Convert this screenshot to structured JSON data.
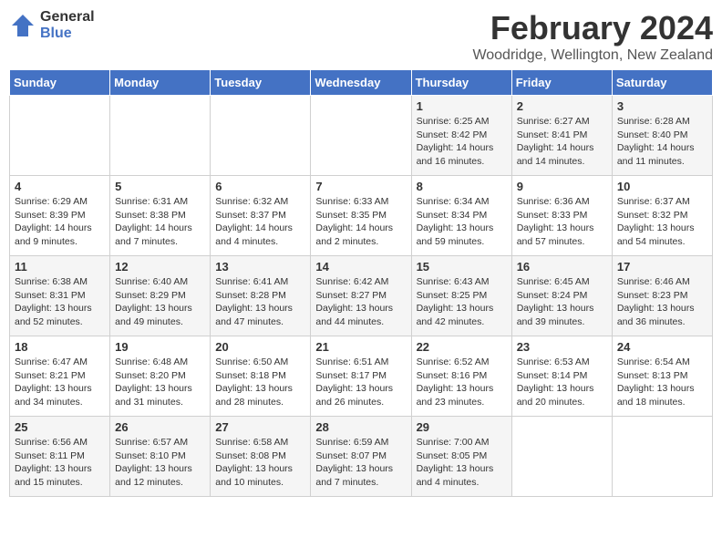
{
  "logo": {
    "general": "General",
    "blue": "Blue"
  },
  "title": "February 2024",
  "subtitle": "Woodridge, Wellington, New Zealand",
  "days_of_week": [
    "Sunday",
    "Monday",
    "Tuesday",
    "Wednesday",
    "Thursday",
    "Friday",
    "Saturday"
  ],
  "weeks": [
    [
      {
        "day": "",
        "info": ""
      },
      {
        "day": "",
        "info": ""
      },
      {
        "day": "",
        "info": ""
      },
      {
        "day": "",
        "info": ""
      },
      {
        "day": "1",
        "info": "Sunrise: 6:25 AM\nSunset: 8:42 PM\nDaylight: 14 hours and 16 minutes."
      },
      {
        "day": "2",
        "info": "Sunrise: 6:27 AM\nSunset: 8:41 PM\nDaylight: 14 hours and 14 minutes."
      },
      {
        "day": "3",
        "info": "Sunrise: 6:28 AM\nSunset: 8:40 PM\nDaylight: 14 hours and 11 minutes."
      }
    ],
    [
      {
        "day": "4",
        "info": "Sunrise: 6:29 AM\nSunset: 8:39 PM\nDaylight: 14 hours and 9 minutes."
      },
      {
        "day": "5",
        "info": "Sunrise: 6:31 AM\nSunset: 8:38 PM\nDaylight: 14 hours and 7 minutes."
      },
      {
        "day": "6",
        "info": "Sunrise: 6:32 AM\nSunset: 8:37 PM\nDaylight: 14 hours and 4 minutes."
      },
      {
        "day": "7",
        "info": "Sunrise: 6:33 AM\nSunset: 8:35 PM\nDaylight: 14 hours and 2 minutes."
      },
      {
        "day": "8",
        "info": "Sunrise: 6:34 AM\nSunset: 8:34 PM\nDaylight: 13 hours and 59 minutes."
      },
      {
        "day": "9",
        "info": "Sunrise: 6:36 AM\nSunset: 8:33 PM\nDaylight: 13 hours and 57 minutes."
      },
      {
        "day": "10",
        "info": "Sunrise: 6:37 AM\nSunset: 8:32 PM\nDaylight: 13 hours and 54 minutes."
      }
    ],
    [
      {
        "day": "11",
        "info": "Sunrise: 6:38 AM\nSunset: 8:31 PM\nDaylight: 13 hours and 52 minutes."
      },
      {
        "day": "12",
        "info": "Sunrise: 6:40 AM\nSunset: 8:29 PM\nDaylight: 13 hours and 49 minutes."
      },
      {
        "day": "13",
        "info": "Sunrise: 6:41 AM\nSunset: 8:28 PM\nDaylight: 13 hours and 47 minutes."
      },
      {
        "day": "14",
        "info": "Sunrise: 6:42 AM\nSunset: 8:27 PM\nDaylight: 13 hours and 44 minutes."
      },
      {
        "day": "15",
        "info": "Sunrise: 6:43 AM\nSunset: 8:25 PM\nDaylight: 13 hours and 42 minutes."
      },
      {
        "day": "16",
        "info": "Sunrise: 6:45 AM\nSunset: 8:24 PM\nDaylight: 13 hours and 39 minutes."
      },
      {
        "day": "17",
        "info": "Sunrise: 6:46 AM\nSunset: 8:23 PM\nDaylight: 13 hours and 36 minutes."
      }
    ],
    [
      {
        "day": "18",
        "info": "Sunrise: 6:47 AM\nSunset: 8:21 PM\nDaylight: 13 hours and 34 minutes."
      },
      {
        "day": "19",
        "info": "Sunrise: 6:48 AM\nSunset: 8:20 PM\nDaylight: 13 hours and 31 minutes."
      },
      {
        "day": "20",
        "info": "Sunrise: 6:50 AM\nSunset: 8:18 PM\nDaylight: 13 hours and 28 minutes."
      },
      {
        "day": "21",
        "info": "Sunrise: 6:51 AM\nSunset: 8:17 PM\nDaylight: 13 hours and 26 minutes."
      },
      {
        "day": "22",
        "info": "Sunrise: 6:52 AM\nSunset: 8:16 PM\nDaylight: 13 hours and 23 minutes."
      },
      {
        "day": "23",
        "info": "Sunrise: 6:53 AM\nSunset: 8:14 PM\nDaylight: 13 hours and 20 minutes."
      },
      {
        "day": "24",
        "info": "Sunrise: 6:54 AM\nSunset: 8:13 PM\nDaylight: 13 hours and 18 minutes."
      }
    ],
    [
      {
        "day": "25",
        "info": "Sunrise: 6:56 AM\nSunset: 8:11 PM\nDaylight: 13 hours and 15 minutes."
      },
      {
        "day": "26",
        "info": "Sunrise: 6:57 AM\nSunset: 8:10 PM\nDaylight: 13 hours and 12 minutes."
      },
      {
        "day": "27",
        "info": "Sunrise: 6:58 AM\nSunset: 8:08 PM\nDaylight: 13 hours and 10 minutes."
      },
      {
        "day": "28",
        "info": "Sunrise: 6:59 AM\nSunset: 8:07 PM\nDaylight: 13 hours and 7 minutes."
      },
      {
        "day": "29",
        "info": "Sunrise: 7:00 AM\nSunset: 8:05 PM\nDaylight: 13 hours and 4 minutes."
      },
      {
        "day": "",
        "info": ""
      },
      {
        "day": "",
        "info": ""
      }
    ]
  ]
}
